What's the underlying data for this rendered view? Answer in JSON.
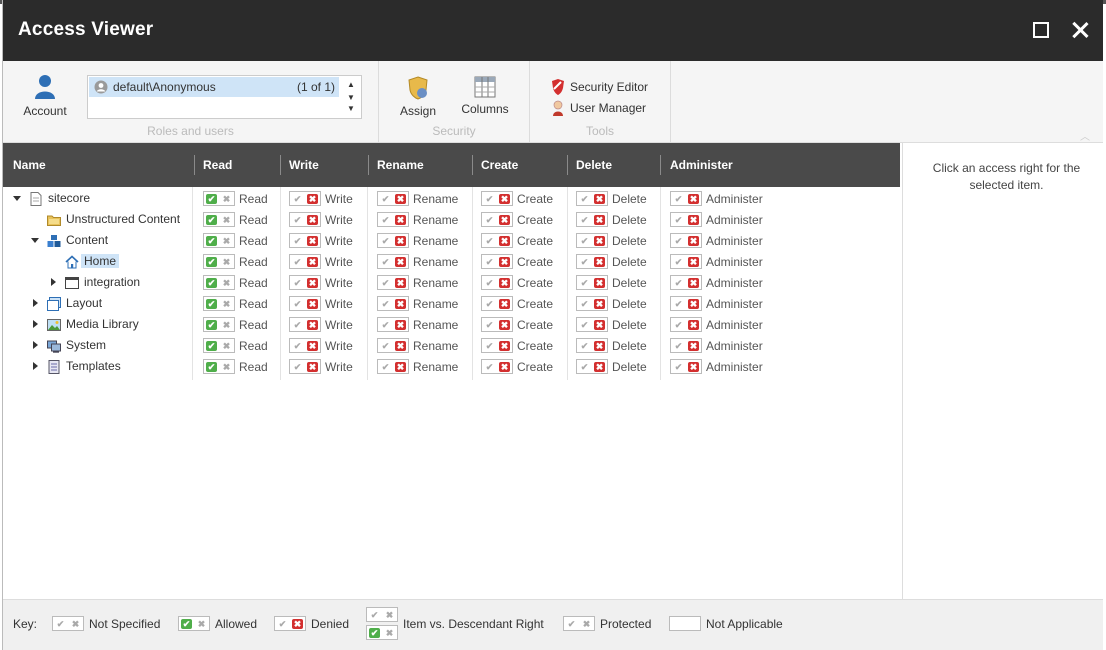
{
  "window": {
    "title": "Access Viewer"
  },
  "ribbon": {
    "account_label": "Account",
    "selected_user": "default\\Anonymous",
    "user_count": "(1 of 1)",
    "roles_group_label": "Roles and users",
    "assign_label": "Assign",
    "columns_label": "Columns",
    "security_group_label": "Security",
    "security_editor_label": "Security Editor",
    "user_manager_label": "User Manager",
    "tools_group_label": "Tools"
  },
  "grid": {
    "headers": [
      "Name",
      "Read",
      "Write",
      "Rename",
      "Create",
      "Delete",
      "Administer"
    ],
    "rows": [
      {
        "name": "sitecore",
        "icon": "page-icon",
        "expander": "down",
        "level": 0
      },
      {
        "name": "Unstructured Content",
        "icon": "folder-icon",
        "expander": "none",
        "level": 1
      },
      {
        "name": "Content",
        "icon": "content-icon",
        "expander": "down",
        "level": 1
      },
      {
        "name": "Home",
        "icon": "home-icon",
        "expander": "none",
        "level": 2,
        "selected": true
      },
      {
        "name": "integration",
        "icon": "window-icon",
        "expander": "right",
        "level": 2
      },
      {
        "name": "Layout",
        "icon": "layout-icon",
        "expander": "right",
        "level": 1
      },
      {
        "name": "Media Library",
        "icon": "image-icon",
        "expander": "right",
        "level": 1
      },
      {
        "name": "System",
        "icon": "system-icon",
        "expander": "right",
        "level": 1
      },
      {
        "name": "Templates",
        "icon": "template-icon",
        "expander": "right",
        "level": 1
      }
    ],
    "permissions": [
      {
        "label": "Read",
        "state": "allowed"
      },
      {
        "label": "Write",
        "state": "denied"
      },
      {
        "label": "Rename",
        "state": "denied"
      },
      {
        "label": "Create",
        "state": "denied"
      },
      {
        "label": "Delete",
        "state": "denied"
      },
      {
        "label": "Administer",
        "state": "denied"
      }
    ]
  },
  "sidepanel": {
    "message": "Click an access right for the selected item."
  },
  "key": {
    "label": "Key:",
    "not_specified": "Not Specified",
    "allowed": "Allowed",
    "denied": "Denied",
    "item_vs_descendant": "Item vs. Descendant Right",
    "protected": "Protected",
    "not_applicable": "Not Applicable"
  },
  "colors": {
    "titlebar": "#2b2b2b",
    "allowed": "#4fae4a",
    "denied": "#d32f2f",
    "selection": "#cfe4f7"
  }
}
